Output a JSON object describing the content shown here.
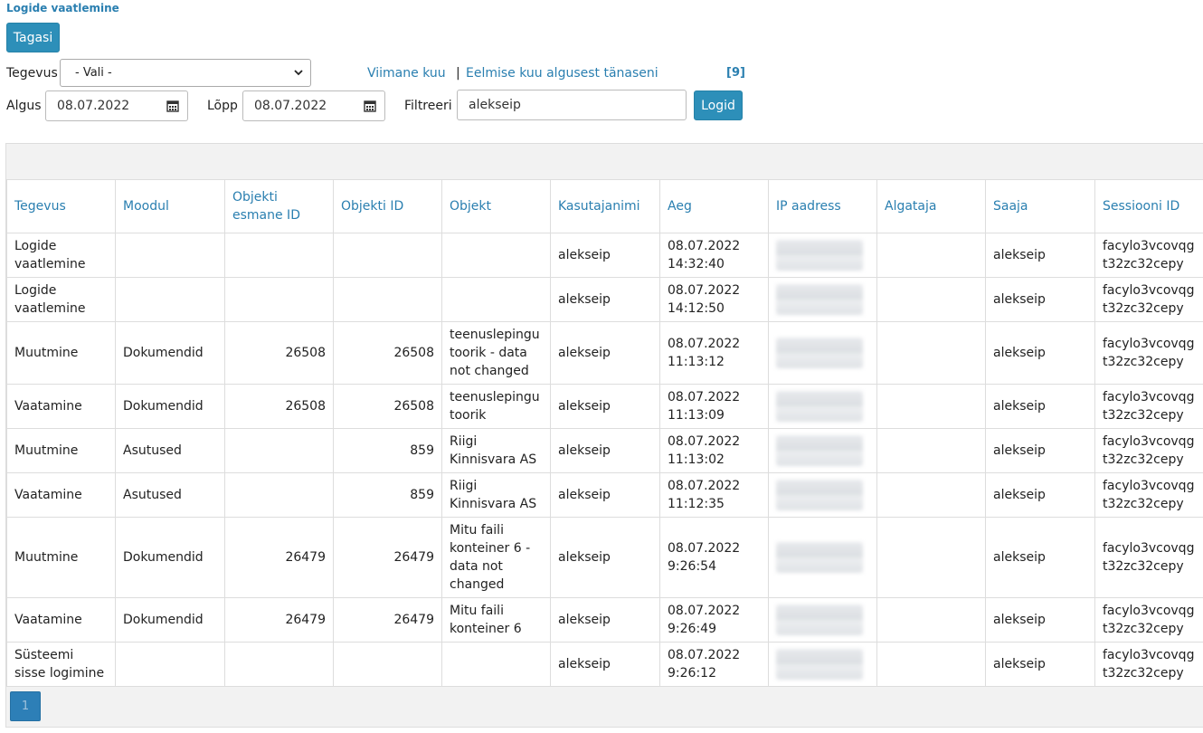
{
  "page": {
    "title": "Logide vaatlemine"
  },
  "toolbar": {
    "back_label": "Tagasi",
    "logs_label": "Logid"
  },
  "filters": {
    "action_label": "Tegevus",
    "action_selected": "- Vali -",
    "start_label": "Algus",
    "start_value": "08.07.2022",
    "end_label": "Lõpp",
    "end_value": "08.07.2022",
    "filter_label": "Filtreeri",
    "filter_value": "alekseip",
    "last_month_link": "Viimane kuu",
    "separator": "|",
    "prev_month_link": "Eelmise kuu algusest tänaseni",
    "result_count": "[9]"
  },
  "table": {
    "headers": [
      "Tegevus",
      "Moodul",
      "Objekti esmane ID",
      "Objekti ID",
      "Objekt",
      "Kasutajanimi",
      "Aeg",
      "IP aadress",
      "Algataja",
      "Saaja",
      "Sessiooni ID"
    ],
    "rows": [
      {
        "tegevus": "Logide vaatlemine",
        "moodul": "",
        "esmane_id": "",
        "objekti_id": "",
        "objekt": "",
        "kasutaja": "alekseip",
        "aeg": "08.07.2022 14:32:40",
        "algataja": "",
        "saaja": "alekseip",
        "sessioon": "facylo3vcovqg t32zc32cepy"
      },
      {
        "tegevus": "Logide vaatlemine",
        "moodul": "",
        "esmane_id": "",
        "objekti_id": "",
        "objekt": "",
        "kasutaja": "alekseip",
        "aeg": "08.07.2022 14:12:50",
        "algataja": "",
        "saaja": "alekseip",
        "sessioon": "facylo3vcovqg t32zc32cepy"
      },
      {
        "tegevus": "Muutmine",
        "moodul": "Dokumendid",
        "esmane_id": "26508",
        "objekti_id": "26508",
        "objekt": "teenuslepingu toorik - data not changed",
        "kasutaja": "alekseip",
        "aeg": "08.07.2022 11:13:12",
        "algataja": "",
        "saaja": "alekseip",
        "sessioon": "facylo3vcovqg t32zc32cepy"
      },
      {
        "tegevus": "Vaatamine",
        "moodul": "Dokumendid",
        "esmane_id": "26508",
        "objekti_id": "26508",
        "objekt": "teenuslepingu toorik",
        "kasutaja": "alekseip",
        "aeg": "08.07.2022 11:13:09",
        "algataja": "",
        "saaja": "alekseip",
        "sessioon": "facylo3vcovqg t32zc32cepy"
      },
      {
        "tegevus": "Muutmine",
        "moodul": "Asutused",
        "esmane_id": "",
        "objekti_id": "859",
        "objekt": "Riigi Kinnisvara AS",
        "kasutaja": "alekseip",
        "aeg": "08.07.2022 11:13:02",
        "algataja": "",
        "saaja": "alekseip",
        "sessioon": "facylo3vcovqg t32zc32cepy"
      },
      {
        "tegevus": "Vaatamine",
        "moodul": "Asutused",
        "esmane_id": "",
        "objekti_id": "859",
        "objekt": "Riigi Kinnisvara AS",
        "kasutaja": "alekseip",
        "aeg": "08.07.2022 11:12:35",
        "algataja": "",
        "saaja": "alekseip",
        "sessioon": "facylo3vcovqg t32zc32cepy"
      },
      {
        "tegevus": "Muutmine",
        "moodul": "Dokumendid",
        "esmane_id": "26479",
        "objekti_id": "26479",
        "objekt": "Mitu faili konteiner 6 - data not changed",
        "kasutaja": "alekseip",
        "aeg": "08.07.2022 9:26:54",
        "algataja": "",
        "saaja": "alekseip",
        "sessioon": "facylo3vcovqg t32zc32cepy"
      },
      {
        "tegevus": "Vaatamine",
        "moodul": "Dokumendid",
        "esmane_id": "26479",
        "objekti_id": "26479",
        "objekt": "Mitu faili konteiner 6",
        "kasutaja": "alekseip",
        "aeg": "08.07.2022 9:26:49",
        "algataja": "",
        "saaja": "alekseip",
        "sessioon": "facylo3vcovqg t32zc32cepy"
      },
      {
        "tegevus": "Süsteemi sisse logimine",
        "moodul": "",
        "esmane_id": "",
        "objekti_id": "",
        "objekt": "",
        "kasutaja": "alekseip",
        "aeg": "08.07.2022 9:26:12",
        "algataja": "",
        "saaja": "alekseip",
        "sessioon": "facylo3vcovqg t32zc32cepy"
      }
    ]
  },
  "pagination": {
    "current_page": "1"
  },
  "icons": {
    "calendar": "calendar-icon",
    "dropdown": "chevron-down-icon"
  },
  "colors": {
    "accent": "#2d8fb9",
    "link": "#2a7fb0",
    "pager": "#2d7fb7"
  }
}
